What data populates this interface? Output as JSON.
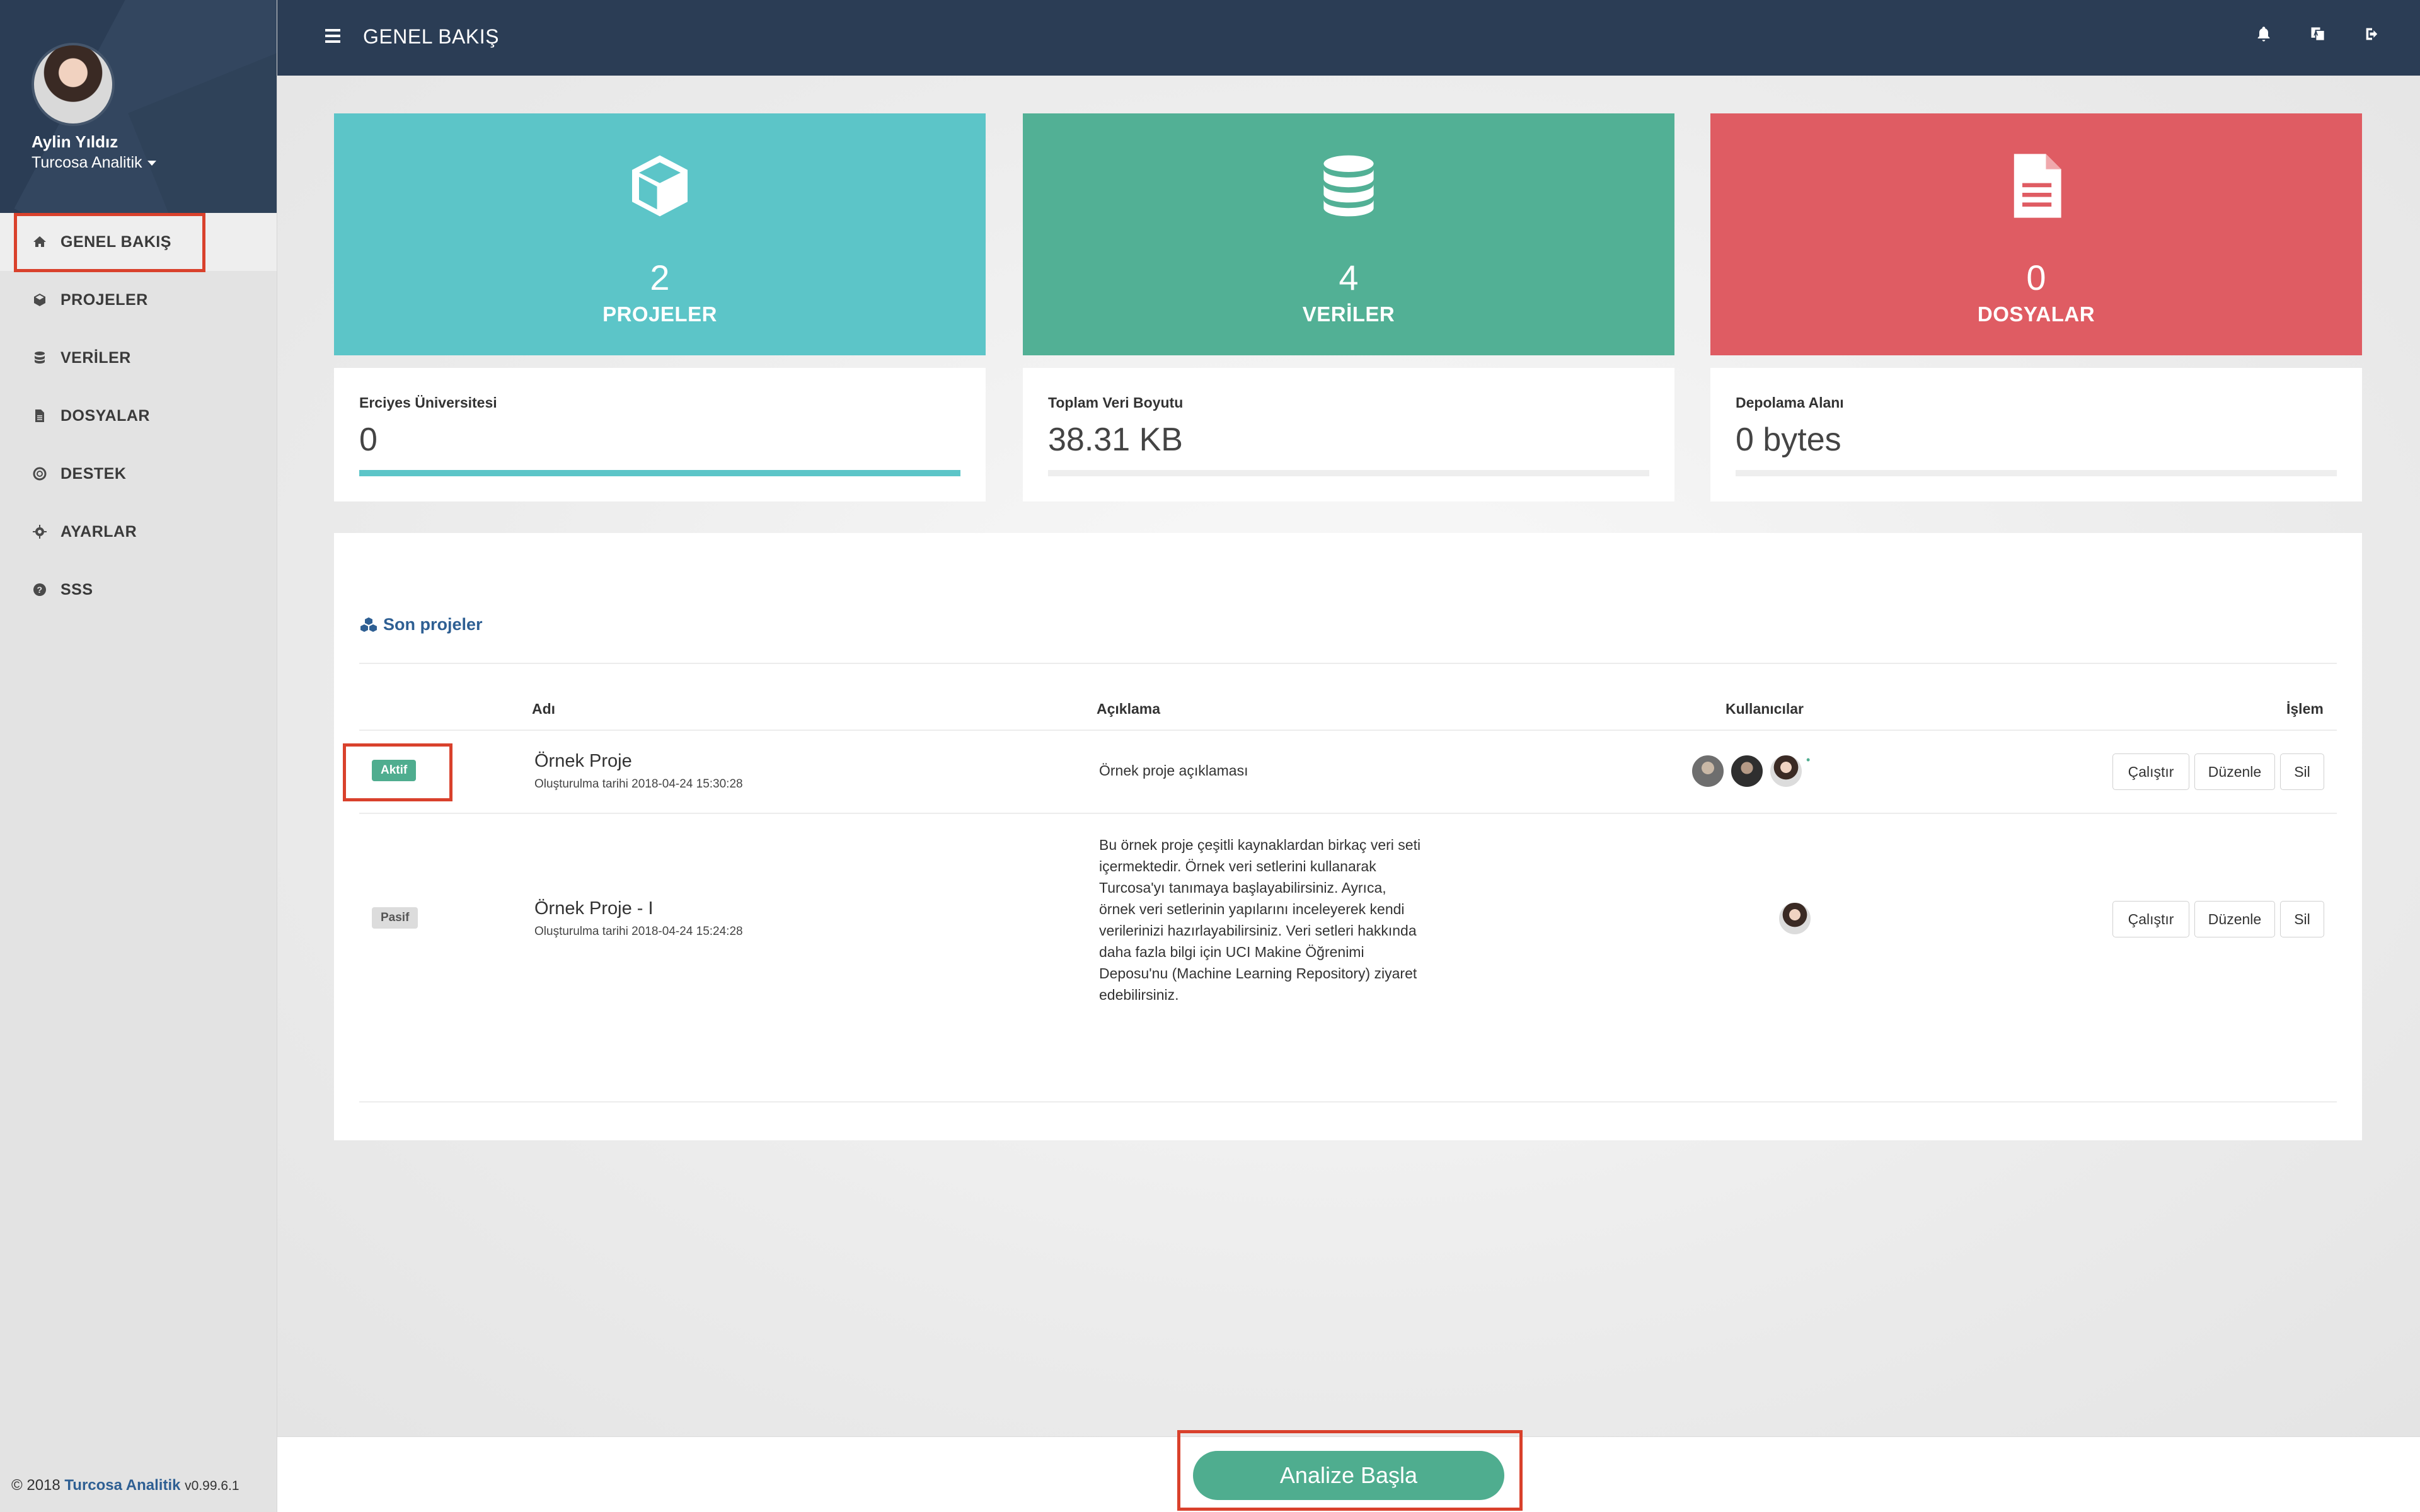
{
  "sidebar": {
    "user_name": "Aylin Yıldız",
    "user_org": "Turcosa Analitik",
    "items": [
      {
        "label": "GENEL BAKIŞ",
        "icon": "home-icon"
      },
      {
        "label": "PROJELER",
        "icon": "cube-icon"
      },
      {
        "label": "VERİLER",
        "icon": "database-icon"
      },
      {
        "label": "DOSYALAR",
        "icon": "file-icon"
      },
      {
        "label": "DESTEK",
        "icon": "lifebuoy-icon"
      },
      {
        "label": "AYARLAR",
        "icon": "gear-icon"
      },
      {
        "label": "SSS",
        "icon": "question-icon"
      }
    ],
    "footer": {
      "copyright": "© 2018",
      "brand": "Turcosa Analitik",
      "version": "v0.99.6.1"
    }
  },
  "header": {
    "title": "GENEL BAKIŞ"
  },
  "stats": [
    {
      "value": "2",
      "label": "PROJELER",
      "color": "#5cc5c8",
      "icon": "cube-icon"
    },
    {
      "value": "4",
      "label": "VERİLER",
      "color": "#52b095",
      "icon": "database-icon"
    },
    {
      "value": "0",
      "label": "DOSYALAR",
      "color": "#df5c63",
      "icon": "file-text-icon"
    }
  ],
  "info": [
    {
      "title": "Erciyes Üniversitesi",
      "value": "0",
      "progress": 1.0
    },
    {
      "title": "Toplam Veri Boyutu",
      "value": "38.31 KB",
      "progress": 0
    },
    {
      "title": "Depolama Alanı",
      "value": "0 bytes",
      "progress": 0
    }
  ],
  "recent": {
    "title": "Son projeler",
    "columns": [
      "Adı",
      "Açıklama",
      "Kullanıcılar",
      "İşlem"
    ],
    "rows": [
      {
        "status": "Aktif",
        "name": "Örnek Proje",
        "date": "Oluşturulma tarihi 2018-04-24 15:30:28",
        "description": "Örnek proje açıklaması",
        "users": 3,
        "extra": "•"
      },
      {
        "status": "Pasif",
        "name": "Örnek Proje - I",
        "date": "Oluşturulma tarihi 2018-04-24 15:24:28",
        "description_lines": [
          "Bu örnek proje çeşitli kaynaklardan birkaç veri seti",
          "içermektedir. Örnek veri setlerini kullanarak",
          "Turcosa'yı tanımaya başlayabilirsiniz. Ayrıca,",
          "örnek veri setlerinin yapılarını inceleyerek kendi",
          "verilerinizi hazırlayabilirsiniz. Veri setleri hakkında",
          "daha fazla bilgi için UCI Makine Öğrenimi",
          "Deposu'nu (Machine Learning Repository) ziyaret",
          "edebilirsiniz."
        ],
        "users": 1
      }
    ],
    "actions": {
      "run": "Çalıştır",
      "edit": "Düzenle",
      "delete": "Sil"
    }
  },
  "start_button": "Analize Başla",
  "colors": {
    "navy": "#2b3d55",
    "accent_green": "#4fad8f",
    "highlight": "#d9412c",
    "link": "#2e5f93"
  }
}
